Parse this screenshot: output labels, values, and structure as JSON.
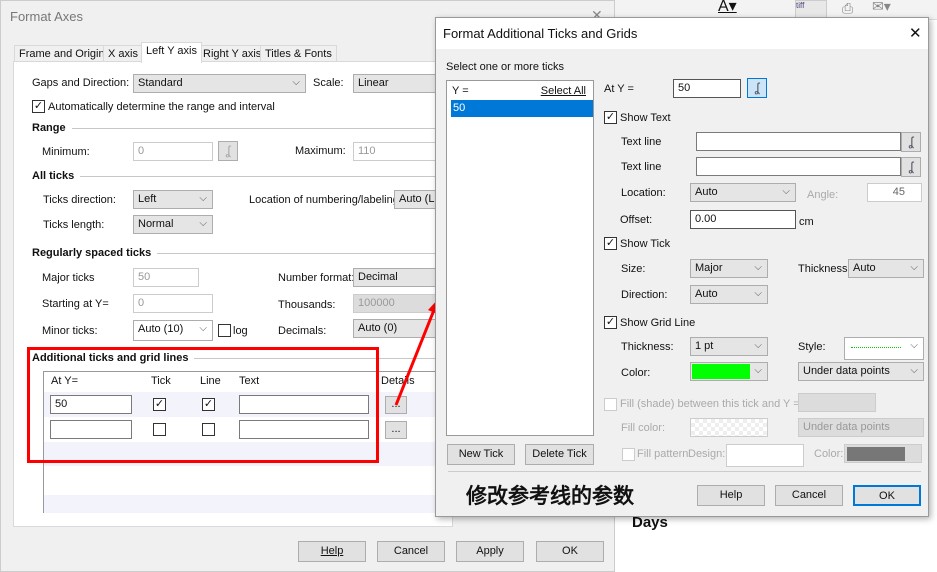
{
  "background": {
    "days_label": "Days"
  },
  "format_axes": {
    "title": "Format Axes",
    "tabs": [
      "Frame and Origin",
      "X axis",
      "Left Y axis",
      "Right Y axis",
      "Titles & Fonts"
    ],
    "gaps_label": "Gaps and Direction:",
    "gaps_value": "Standard",
    "scale_label": "Scale:",
    "scale_value": "Linear",
    "auto_range_label": "Automatically determine the range and interval",
    "range_heading": "Range",
    "minimum_label": "Minimum:",
    "minimum_value": "0",
    "maximum_label": "Maximum:",
    "maximum_value": "110",
    "all_ticks_heading": "All ticks",
    "ticks_direction_label": "Ticks direction:",
    "ticks_direction_value": "Left",
    "location_label": "Location of numbering/labeling:",
    "location_value": "Auto (Le",
    "ticks_length_label": "Ticks length:",
    "ticks_length_value": "Normal",
    "regular_heading": "Regularly spaced ticks",
    "major_label": "Major ticks",
    "major_value": "50",
    "number_format_label": "Number format:",
    "number_format_value": "Decimal",
    "starting_label": "Starting at Y=",
    "starting_value": "0",
    "thousands_label": "Thousands:",
    "thousands_value": "100000",
    "minor_label": "Minor ticks:",
    "minor_value": "Auto (10)",
    "log_label": "log",
    "decimals_label": "Decimals:",
    "decimals_value": "Auto (0)",
    "additional_heading": "Additional ticks and grid lines",
    "table_headers": [
      "At Y=",
      "Tick",
      "Line",
      "Text",
      "Details"
    ],
    "rows": [
      {
        "at_y": "50",
        "tick": true,
        "line": true,
        "text": "",
        "details": "..."
      },
      {
        "at_y": "",
        "tick": false,
        "line": false,
        "text": "",
        "details": "..."
      }
    ],
    "buttons": {
      "help": "Help",
      "cancel": "Cancel",
      "apply": "Apply",
      "ok": "OK"
    }
  },
  "ticks_dialog": {
    "title": "Format Additional Ticks and Grids",
    "select_label": "Select one or more ticks",
    "list_header": "Y =",
    "select_all": "Select All",
    "list_items": [
      "50"
    ],
    "at_y_label": "At Y =",
    "at_y_value": "50",
    "show_text_label": "Show Text",
    "text_line_label": "Text line",
    "location_label": "Location:",
    "location_value": "Auto",
    "angle_label": "Angle:",
    "angle_value": "45",
    "offset_label": "Offset:",
    "offset_value": "0.00",
    "offset_unit": "cm",
    "show_tick_label": "Show Tick",
    "size_label": "Size:",
    "size_value": "Major",
    "thickness_label": "Thickness:",
    "tick_thickness_value": "Auto",
    "direction_label": "Direction:",
    "direction_value": "Auto",
    "show_grid_label": "Show Grid Line",
    "grid_thickness_value": "1 pt",
    "style_label": "Style:",
    "color_label": "Color:",
    "grid_color": "#00ff00",
    "layer_value": "Under data points",
    "fill_label": "Fill (shade) between this tick and Y =",
    "fill_color_label": "Fill color:",
    "fill_layer_value": "Under data points",
    "fill_pattern_label": "Fill pattern",
    "design_label": "Design:",
    "pattern_color_label": "Color:",
    "new_tick": "New Tick",
    "delete_tick": "Delete Tick",
    "annotation": "修改参考线的参数",
    "buttons": {
      "help": "Help",
      "cancel": "Cancel",
      "ok": "OK"
    }
  }
}
